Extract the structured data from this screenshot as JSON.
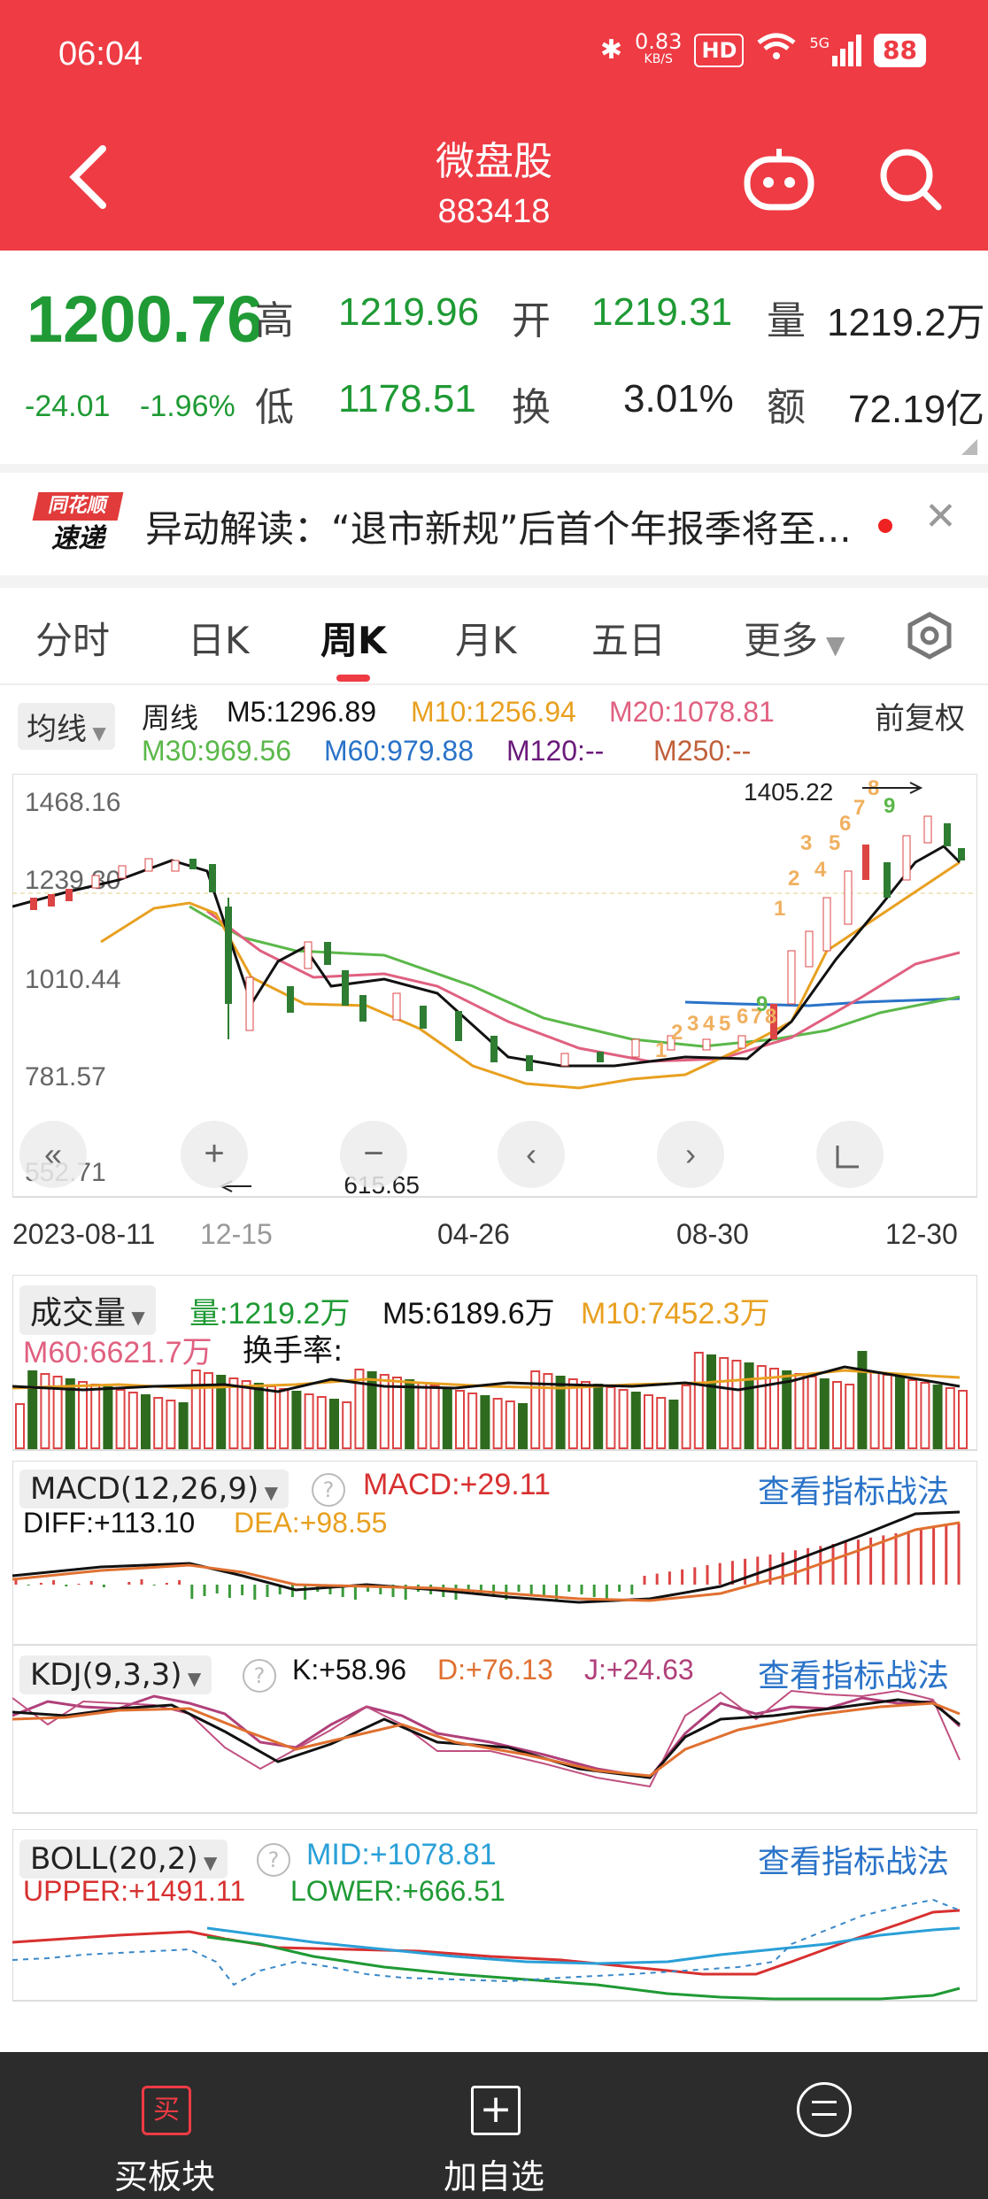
{
  "status": {
    "time": "06:04",
    "net_speed": "0.83",
    "net_unit": "KB/S",
    "hd": "HD",
    "signal": "5G",
    "battery": "88"
  },
  "header": {
    "title": "微盘股",
    "code": "883418"
  },
  "quote": {
    "price": "1200.76",
    "change": "-24.01",
    "change_pct": "-1.96%",
    "high_label": "高",
    "high": "1219.96",
    "open_label": "开",
    "open": "1219.31",
    "vol_label": "量",
    "vol": "1219.2万",
    "low_label": "低",
    "low": "1178.51",
    "turn_label": "换",
    "turn": "3.01%",
    "amt_label": "额",
    "amt": "72.19亿"
  },
  "news": {
    "logo_top": "同花顺",
    "logo_bottom": "速递",
    "text": "异动解读：“退市新规”后首个年报季将至...",
    "close_icon": "close-icon"
  },
  "tabs": {
    "items": [
      "分时",
      "日K",
      "周K",
      "月K",
      "五日",
      "更多"
    ],
    "active": "周K"
  },
  "ma": {
    "selector": "均线",
    "period": "周线",
    "m5": "M5:1296.89",
    "m10": "M10:1256.94",
    "m20": "M20:1078.81",
    "m30": "M30:969.56",
    "m60": "M60:979.88",
    "m120": "M120:--",
    "m250": "M250:--",
    "adjust": "前复权"
  },
  "kline": {
    "y_labels": [
      "1468.16",
      "1239.30",
      "1010.44",
      "781.57",
      "552.71"
    ],
    "high_mark": "1405.22",
    "low_mark": "615.65",
    "x_labels": [
      "2023-08-11",
      "12-15",
      "04-26",
      "08-30",
      "12-30"
    ],
    "nine_turn": [
      "1",
      "2",
      "3",
      "4",
      "5",
      "6",
      "7",
      "8",
      "9"
    ]
  },
  "volume": {
    "selector": "成交量",
    "vol": "量:1219.2万",
    "m5": "M5:6189.6万",
    "m10": "M10:7452.3万",
    "m60": "M60:6621.7万",
    "turnover": "换手率:"
  },
  "macd": {
    "selector": "MACD(12,26,9)",
    "macd": "MACD:+29.11",
    "diff": "DIFF:+113.10",
    "dea": "DEA:+98.55",
    "link": "查看指标战法"
  },
  "kdj": {
    "selector": "KDJ(9,3,3)",
    "k": "K:+58.96",
    "d": "D:+76.13",
    "j": "J:+24.63",
    "link": "查看指标战法"
  },
  "boll": {
    "selector": "BOLL(20,2)",
    "mid": "MID:+1078.81",
    "upper": "UPPER:+1491.11",
    "lower": "LOWER:+666.51",
    "link": "查看指标战法"
  },
  "nav": {
    "items": [
      "买板块",
      "加自选",
      ""
    ]
  },
  "colors": {
    "red": "#ee3b44",
    "green": "#1f9a34",
    "orange": "#e8a020",
    "pink": "#e06080",
    "blue": "#2a73c8"
  }
}
